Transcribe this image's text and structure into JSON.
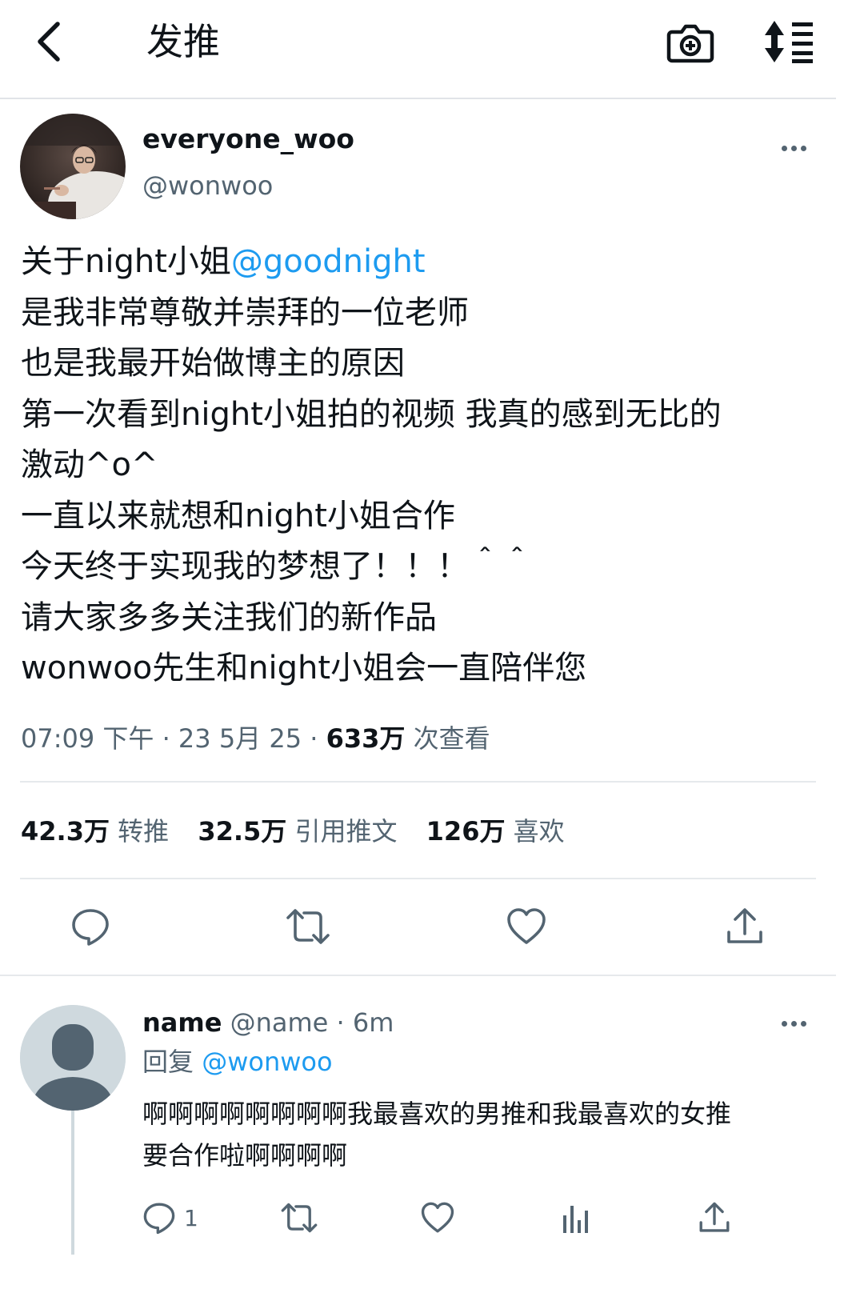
{
  "header": {
    "title": "发推",
    "icons": {
      "back": "chevron-left-icon",
      "camera": "camera-add-icon",
      "sort": "sort-list-icon"
    }
  },
  "tweet": {
    "display_name": "everyone_woo",
    "handle": "@wonwoo",
    "avatar": "user-avatar-photo",
    "body": {
      "line1_text": "关于night小姐",
      "line1_mention": "@goodnight",
      "lines": [
        "是我非常尊敬并崇拜的一位老师",
        "也是我最开始做博主的原因",
        "第一次看到night小姐拍的视频 我真的感到无比的",
        "激动^o^",
        "一直以来就想和night小姐合作",
        "今天终于实现我的梦想了！！！＾＾",
        "请大家多多关注我们的新作品",
        "wonwoo先生和night小姐会一直陪伴您"
      ]
    },
    "meta": {
      "time": "07:09 下午",
      "sep1": " · ",
      "date": "23 5月 25",
      "sep2": " · ",
      "views_count": "633万",
      "views_label": " 次查看"
    },
    "stats": {
      "retweets_count": "42.3万",
      "retweets_label": "转推",
      "quotes_count": "32.5万",
      "quotes_label": "引用推文",
      "likes_count": "126万",
      "likes_label": "喜欢"
    },
    "actions": [
      "reply-icon",
      "retweet-icon",
      "like-icon",
      "share-icon"
    ]
  },
  "reply": {
    "name": "name",
    "handle": "@name",
    "sep": " · ",
    "time": "6m",
    "replying_label": "回复",
    "replying_to": "@wonwoo",
    "avatar": "default-avatar",
    "body_lines": [
      "啊啊啊啊啊啊啊啊我最喜欢的男推和我最喜欢的女推",
      "要合作啦啊啊啊啊"
    ],
    "reply_count": "1",
    "actions": [
      "reply-icon",
      "retweet-icon",
      "like-icon",
      "analytics-icon",
      "share-icon"
    ]
  },
  "colors": {
    "text_primary": "#0f1419",
    "text_secondary": "#536471",
    "link": "#1d9bf0",
    "divider": "#e6e9ec",
    "avatar_placeholder": "#cfd9de"
  }
}
